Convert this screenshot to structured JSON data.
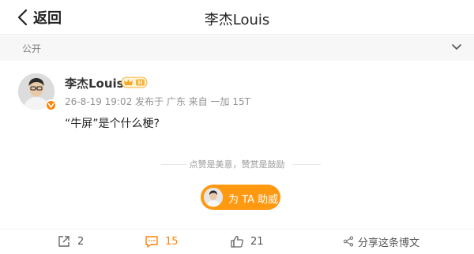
{
  "nav": {
    "back_label": "返回",
    "title": "李杰Louis"
  },
  "visibility": {
    "label": "公开",
    "icon": "chevron-down-icon"
  },
  "post": {
    "author": "李杰Louis",
    "member_badge_icon": "crown-badge-icon",
    "verified_icon": "verified-v-icon",
    "meta": "26-8-19 19:02 发布于 广东 来自 一加 15T",
    "text": "“牛屏”是个什么梗?"
  },
  "reward": {
    "caption": "点赞是美意，赞赏是鼓励",
    "button_label": "为 TA 助威"
  },
  "toolbar": {
    "repost_count": "2",
    "comment_count": "15",
    "like_count": "21",
    "share_label": "分享这条博文"
  },
  "colors": {
    "accent": "#ff8200",
    "button": "#ff9912",
    "muted": "#939393"
  }
}
